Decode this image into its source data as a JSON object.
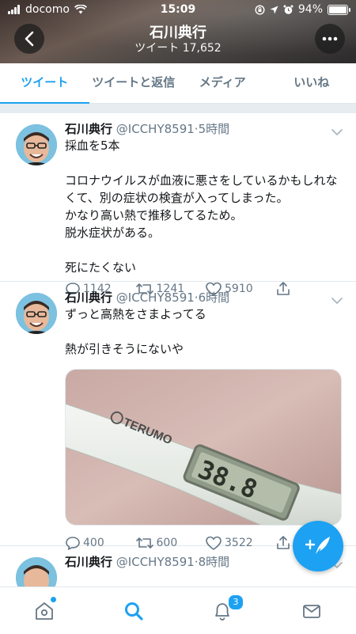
{
  "status_bar": {
    "carrier": "docomo",
    "time": "15:09",
    "battery": "94%"
  },
  "header": {
    "name": "石川典行",
    "tweet_count": "ツイート 17,652"
  },
  "tabs": [
    {
      "label": "ツイート",
      "active": true
    },
    {
      "label": "ツイートと返信",
      "active": false
    },
    {
      "label": "メディア",
      "active": false
    },
    {
      "label": "いいね",
      "active": false
    }
  ],
  "tweets": [
    {
      "name": "石川典行",
      "handle": "@ICCHY8591",
      "separator": "·",
      "time": "5時間",
      "lines": [
        "採血を5本",
        "",
        "コロナウイルスが血液に悪さをしているかもしれな",
        "くて、別の症状の検査が入ってしまった。",
        "かなり高い熱で推移してるため。",
        "脱水症状がある。",
        "",
        "死にたくない"
      ],
      "replies": "1142",
      "retweets": "1241",
      "likes": "5910"
    },
    {
      "name": "石川典行",
      "handle": "@ICCHY8591",
      "separator": "·",
      "time": "6時間",
      "lines": [
        "ずっと高熱をさまよってる",
        "",
        "熱が引きそうにないや"
      ],
      "media": {
        "brand": "TERUMO",
        "reading": "38.8"
      },
      "replies": "400",
      "retweets": "600",
      "likes": "3522"
    },
    {
      "name": "石川典行",
      "handle": "@ICCHY8591",
      "separator": "·",
      "time": "8時間"
    }
  ],
  "bottom_nav": {
    "notifications_badge": "3",
    "items": [
      "home-icon",
      "search-icon",
      "bell-icon",
      "mail-icon"
    ]
  },
  "colors": {
    "accent": "#1da1f2",
    "muted": "#657786",
    "border": "#e1e8ed"
  }
}
